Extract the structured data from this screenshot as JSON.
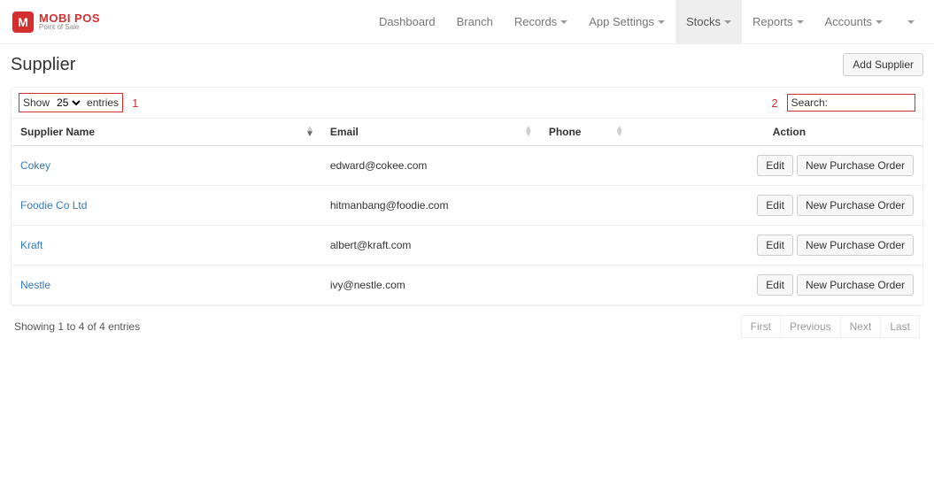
{
  "logo": {
    "title": "MOBI POS",
    "sub": "Point of Sale"
  },
  "nav": {
    "items": [
      {
        "label": "Dashboard",
        "dropdown": false,
        "active": false
      },
      {
        "label": "Branch",
        "dropdown": false,
        "active": false
      },
      {
        "label": "Records",
        "dropdown": true,
        "active": false
      },
      {
        "label": "App Settings",
        "dropdown": true,
        "active": false
      },
      {
        "label": "Stocks",
        "dropdown": true,
        "active": true
      },
      {
        "label": "Reports",
        "dropdown": true,
        "active": false
      },
      {
        "label": "Accounts",
        "dropdown": true,
        "active": false
      },
      {
        "label": "",
        "dropdown": true,
        "active": false
      }
    ]
  },
  "page": {
    "title": "Supplier",
    "add_button": "Add Supplier"
  },
  "controls": {
    "show_label_pre": "Show",
    "show_value": "25",
    "show_label_post": "entries",
    "annot_left": "1",
    "annot_right": "2",
    "search_label": "Search:",
    "search_value": ""
  },
  "table": {
    "headers": {
      "name": "Supplier Name",
      "email": "Email",
      "phone": "Phone",
      "action": "Action"
    },
    "rows": [
      {
        "name": "Cokey",
        "email": "edward@cokee.com",
        "phone": ""
      },
      {
        "name": "Foodie Co Ltd",
        "email": "hitmanbang@foodie.com",
        "phone": ""
      },
      {
        "name": "Kraft",
        "email": "albert@kraft.com",
        "phone": ""
      },
      {
        "name": "Nestle",
        "email": "ivy@nestle.com",
        "phone": ""
      }
    ],
    "row_buttons": {
      "edit": "Edit",
      "npo": "New Purchase Order"
    }
  },
  "footer": {
    "info": "Showing 1 to 4 of 4 entries",
    "pager": {
      "first": "First",
      "prev": "Previous",
      "next": "Next",
      "last": "Last"
    }
  }
}
